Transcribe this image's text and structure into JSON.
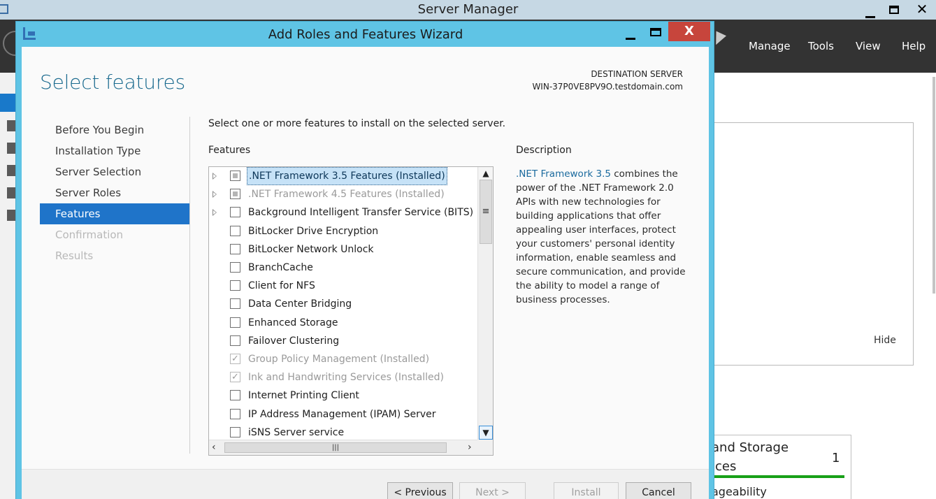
{
  "server_manager": {
    "title": "Server Manager",
    "menu": {
      "manage": "Manage",
      "tools": "Tools",
      "view": "View",
      "help": "Help"
    },
    "hide_label": "Hide",
    "card": {
      "title_line1": "and Storage",
      "title_line2": "ices",
      "count": "1",
      "item": "ageability",
      "bar_color": "#18a018"
    }
  },
  "wizard": {
    "title": "Add Roles and Features Wizard",
    "close_glyph": "X",
    "heading": "Select features",
    "destination_label": "DESTINATION SERVER",
    "destination_name": "WIN-37P0VE8PV9O.testdomain.com",
    "steps": [
      {
        "label": "Before You Begin",
        "state": "normal"
      },
      {
        "label": "Installation Type",
        "state": "normal"
      },
      {
        "label": "Server Selection",
        "state": "normal"
      },
      {
        "label": "Server Roles",
        "state": "normal"
      },
      {
        "label": "Features",
        "state": "active"
      },
      {
        "label": "Confirmation",
        "state": "disabled"
      },
      {
        "label": "Results",
        "state": "disabled"
      }
    ],
    "instructions": "Select one or more features to install on the selected server.",
    "features_label": "Features",
    "features": [
      {
        "label": ".NET Framework 3.5 Features (Installed)",
        "expandable": true,
        "check": "partial",
        "installed": false,
        "selected": true
      },
      {
        "label": ".NET Framework 4.5 Features (Installed)",
        "expandable": true,
        "check": "partial",
        "installed": true,
        "selected": false
      },
      {
        "label": "Background Intelligent Transfer Service (BITS)",
        "expandable": true,
        "check": "none",
        "installed": false,
        "selected": false
      },
      {
        "label": "BitLocker Drive Encryption",
        "expandable": false,
        "check": "none",
        "installed": false,
        "selected": false
      },
      {
        "label": "BitLocker Network Unlock",
        "expandable": false,
        "check": "none",
        "installed": false,
        "selected": false
      },
      {
        "label": "BranchCache",
        "expandable": false,
        "check": "none",
        "installed": false,
        "selected": false
      },
      {
        "label": "Client for NFS",
        "expandable": false,
        "check": "none",
        "installed": false,
        "selected": false
      },
      {
        "label": "Data Center Bridging",
        "expandable": false,
        "check": "none",
        "installed": false,
        "selected": false
      },
      {
        "label": "Enhanced Storage",
        "expandable": false,
        "check": "none",
        "installed": false,
        "selected": false
      },
      {
        "label": "Failover Clustering",
        "expandable": false,
        "check": "none",
        "installed": false,
        "selected": false
      },
      {
        "label": "Group Policy Management (Installed)",
        "expandable": false,
        "check": "checked",
        "installed": true,
        "selected": false
      },
      {
        "label": "Ink and Handwriting Services (Installed)",
        "expandable": false,
        "check": "checked",
        "installed": true,
        "selected": false
      },
      {
        "label": "Internet Printing Client",
        "expandable": false,
        "check": "none",
        "installed": false,
        "selected": false
      },
      {
        "label": "IP Address Management (IPAM) Server",
        "expandable": false,
        "check": "none",
        "installed": false,
        "selected": false
      },
      {
        "label": "iSNS Server service",
        "expandable": false,
        "check": "none",
        "installed": false,
        "selected": false
      }
    ],
    "description_label": "Description",
    "description_link": ".NET Framework 3.5",
    "description_text": " combines the power of the .NET Framework 2.0 APIs with new technologies for building applications that offer appealing user interfaces, protect your customers' personal identity information, enable seamless and secure communication, and provide the ability to model a range of business processes.",
    "buttons": {
      "previous": "< Previous",
      "next": "Next >",
      "install": "Install",
      "cancel": "Cancel"
    },
    "accent_color": "#1f74c9"
  }
}
